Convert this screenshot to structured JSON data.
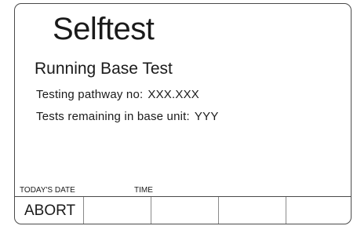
{
  "screen": {
    "title": "Selftest",
    "subtitle": "Running Base Test",
    "pathway": {
      "label": "Testing pathway no:",
      "value": "XXX.XXX"
    },
    "remaining": {
      "label": "Tests remaining in base unit:",
      "value": "YYY"
    }
  },
  "status_bar": {
    "date_label": "TODAY'S DATE",
    "time_label": "TIME"
  },
  "softkeys": [
    {
      "label": "ABORT"
    },
    {
      "label": ""
    },
    {
      "label": ""
    },
    {
      "label": ""
    },
    {
      "label": ""
    }
  ]
}
